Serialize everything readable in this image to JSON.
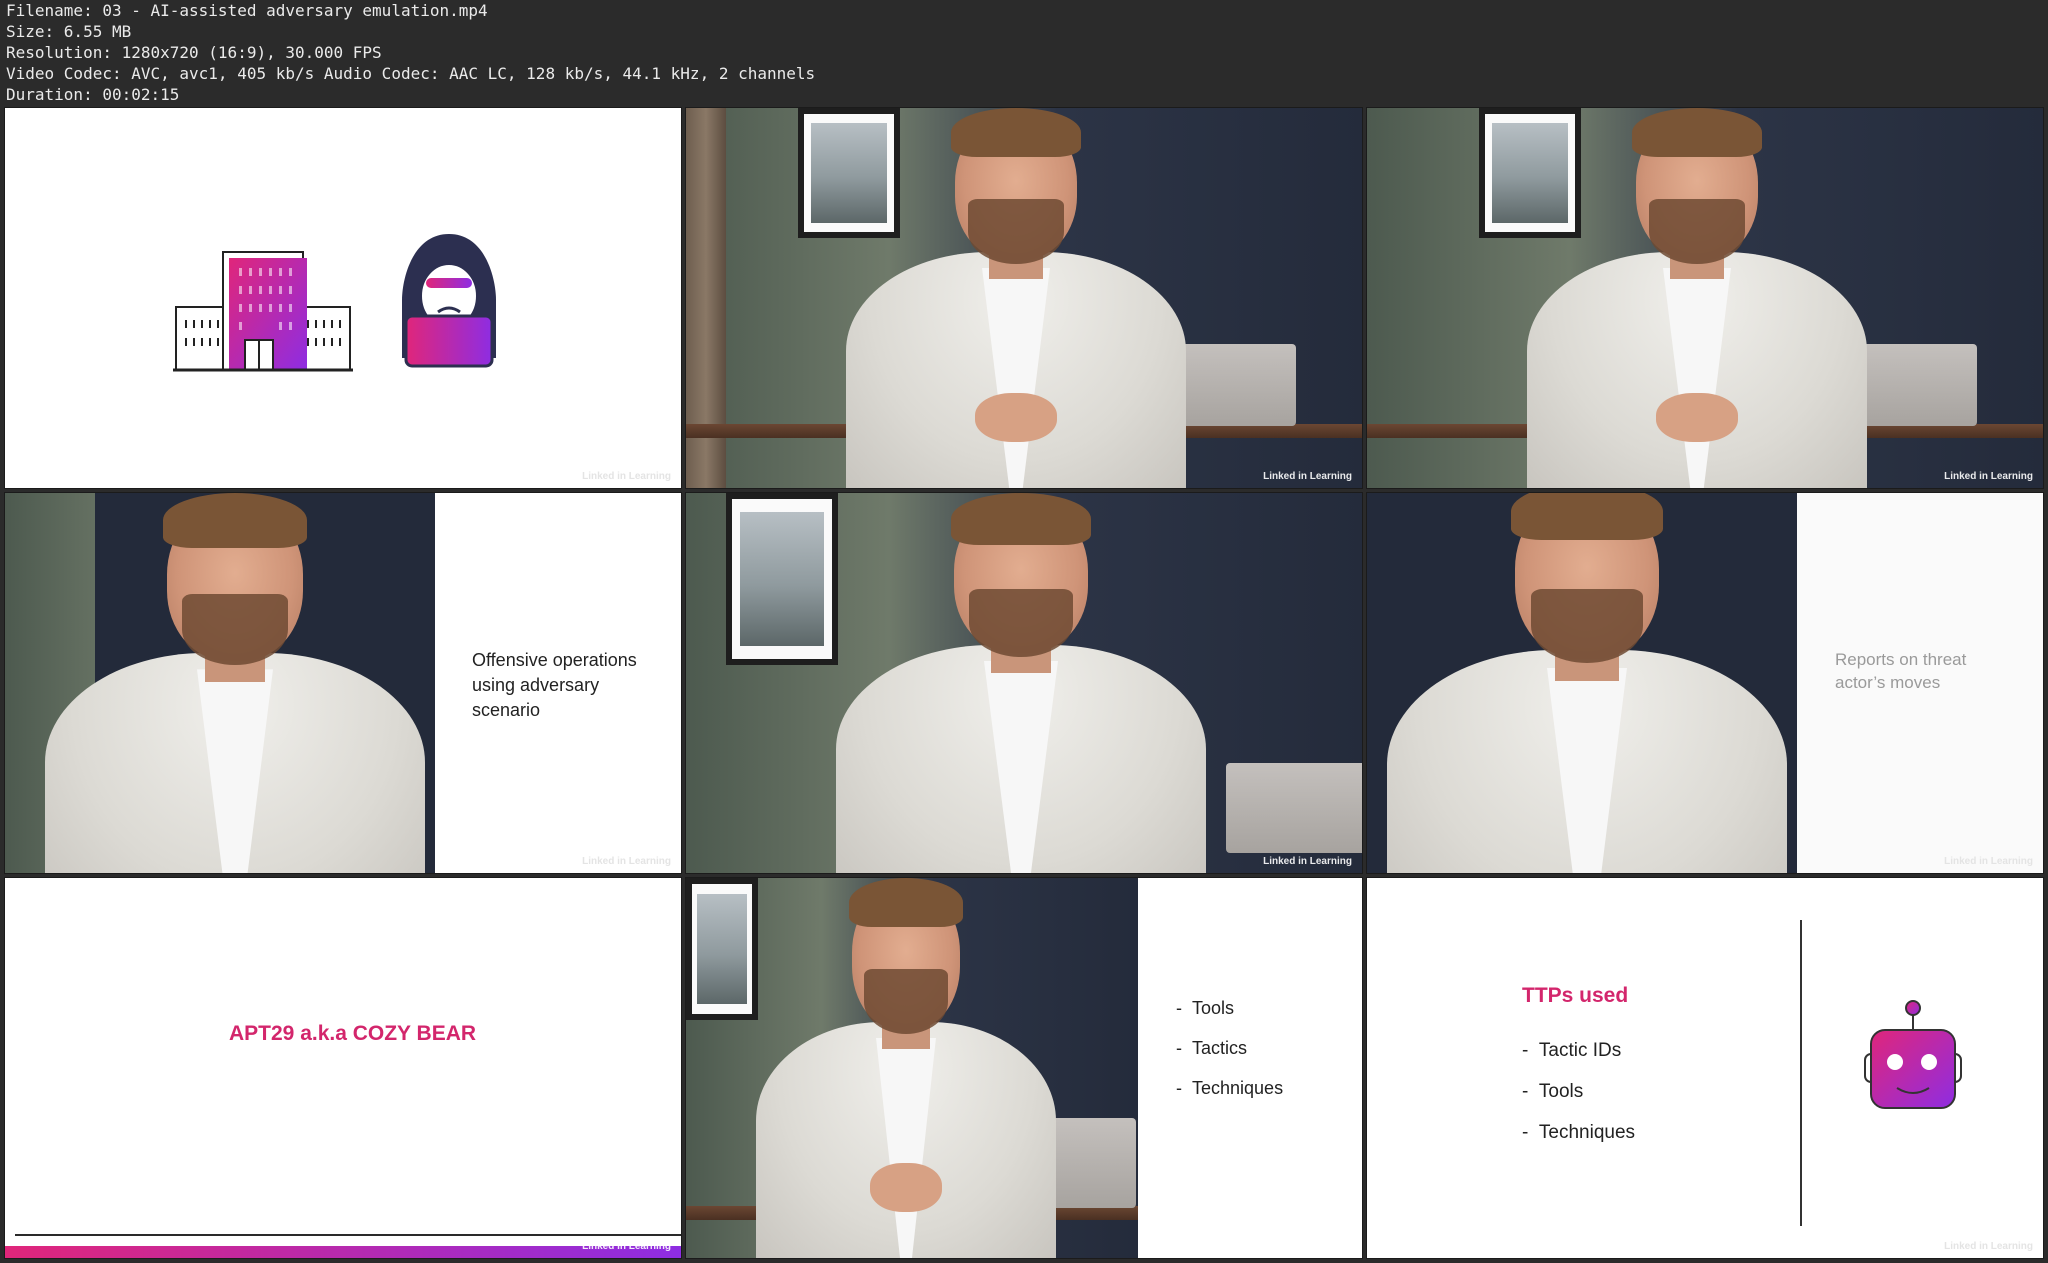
{
  "header": {
    "filename": "Filename: 03 - AI-assisted adversary emulation.mp4",
    "size": "Size: 6.55 MB",
    "resolution": "Resolution: 1280x720 (16:9), 30.000 FPS",
    "codec": "Video Codec: AVC, avc1, 405 kb/s Audio Codec: AAC LC, 128 kb/s, 44.1 kHz, 2 channels",
    "duration": "Duration: 00:02:15"
  },
  "watermark": "Linked in Learning",
  "frames": {
    "f4": {
      "text": "Offensive operations using adversary scenario"
    },
    "f6": {
      "text": "Reports on threat actor’s moves"
    },
    "f7": {
      "title": "APT29 a.k.a COZY BEAR"
    },
    "f8": {
      "bullets": [
        "Tools",
        "Tactics",
        "Techniques"
      ]
    },
    "f9": {
      "title": "TTPs used",
      "bullets": [
        "Tactic IDs",
        "Tools",
        "Techniques"
      ]
    }
  },
  "colors": {
    "accent_pink": "#d3266c",
    "accent_purple": "#8a2be2"
  },
  "icons": [
    "building-icon",
    "hacker-icon",
    "robot-icon"
  ]
}
